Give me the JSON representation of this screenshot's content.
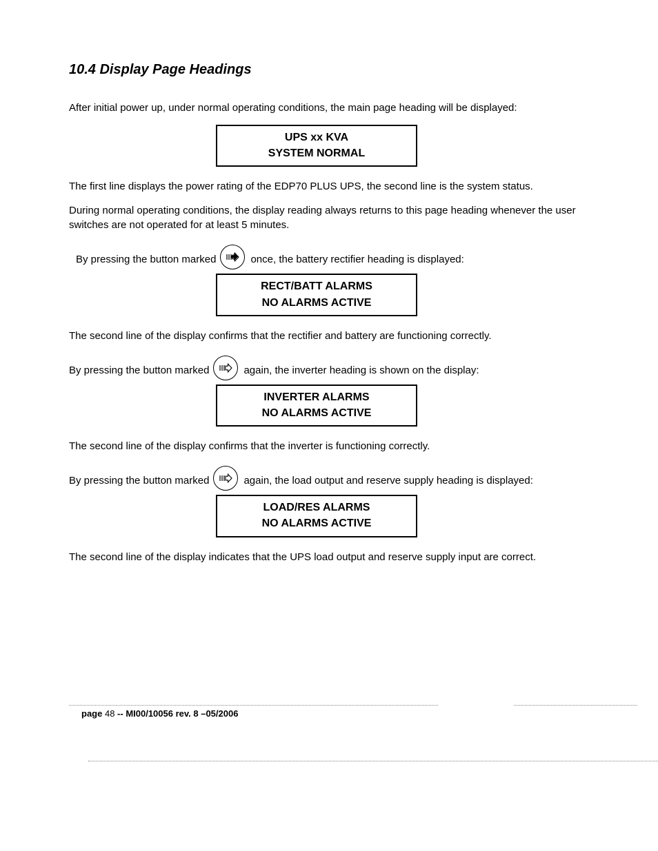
{
  "heading": "10.4    Display Page Headings",
  "para_intro": "After initial power up, under normal operating conditions, the main page heading will be displayed:",
  "display1": {
    "line1": "UPS xx KVA",
    "line2": "SYSTEM NORMAL"
  },
  "para_after1": "The first line displays the power rating of the EDP70 PLUS UPS, the second line is the system status.",
  "para_after1b": "During normal operating conditions, the display reading always returns to this page heading whenever the user switches are not operated for at least 5 minutes.",
  "press1_pre": "By pressing the button marked",
  "press1_post": "once, the battery rectifier heading is displayed:",
  "display2": {
    "line1": "RECT/BATT ALARMS",
    "line2": "NO ALARMS ACTIVE"
  },
  "para_after2": "The second line of the display confirms that the rectifier and battery are functioning correctly.",
  "press2_pre": "By pressing the button marked",
  "press2_post": "again, the inverter heading is shown on the display:",
  "display3": {
    "line1": "INVERTER ALARMS",
    "line2": "NO ALARMS ACTIVE"
  },
  "para_after3": "The second line of the display confirms that the inverter is functioning correctly.",
  "press3_pre": "By pressing the button marked",
  "press3_post": "again, the load output and reserve supply heading is displayed:",
  "display4": {
    "line1": "LOAD/RES ALARMS",
    "line2": "NO ALARMS ACTIVE"
  },
  "para_after4": "The second line of the display indicates that the UPS load output and reserve supply input are correct.",
  "footer": {
    "page_label": "page ",
    "page_num": "48",
    "doc_ref": " -- MI00/10056 rev. 8 –05/2006"
  }
}
